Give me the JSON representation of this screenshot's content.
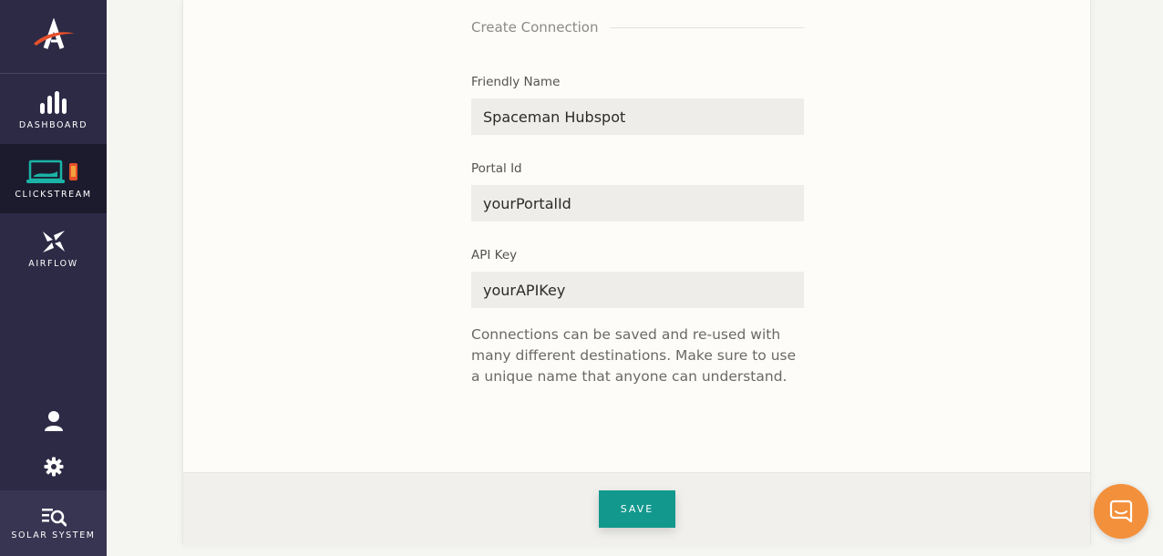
{
  "sidebar": {
    "items": [
      {
        "label": "Dashboard",
        "icon": "bar-chart-icon"
      },
      {
        "label": "Clickstream",
        "icon": "laptop-phone-icon"
      },
      {
        "label": "Airflow",
        "icon": "airflow-icon"
      }
    ],
    "active": "Clickstream",
    "bottom_items": [
      {
        "icon": "user-icon"
      },
      {
        "icon": "gear-icon"
      }
    ],
    "solar_system_label": "Solar System"
  },
  "form": {
    "section_title": "Create Connection",
    "fields": [
      {
        "label": "Friendly Name",
        "value": "Spaceman Hubspot"
      },
      {
        "label": "Portal Id",
        "value": "yourPortalId"
      },
      {
        "label": "API Key",
        "value": "yourAPIKey"
      }
    ],
    "help_text": "Connections can be saved and re-used with many different destinations. Make sure to use a unique name that anyone can understand.",
    "save_label": "Save"
  },
  "chat": {
    "icon": "chat-icon"
  },
  "colors": {
    "sidebar_bg": "#2c2a45",
    "accent_teal": "#13988e",
    "chat_orange": "#f3903c",
    "logo_red": "#e8502a"
  }
}
